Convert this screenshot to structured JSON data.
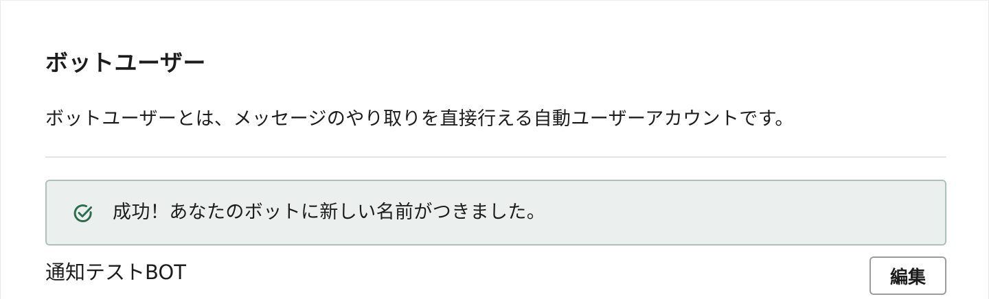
{
  "section": {
    "title": "ボットユーザー",
    "description": "ボットユーザーとは、メッセージのやり取りを直接行える自動ユーザーアカウントです。"
  },
  "alert": {
    "icon": "check-circle-icon",
    "message": "成功！あなたのボットに新しい名前がつきました。",
    "colors": {
      "background": "#ebf0ee",
      "border": "#a9c4b7",
      "icon": "#2b6e4f"
    }
  },
  "bot": {
    "name": "通知テストBOT",
    "edit_label": "編集"
  }
}
